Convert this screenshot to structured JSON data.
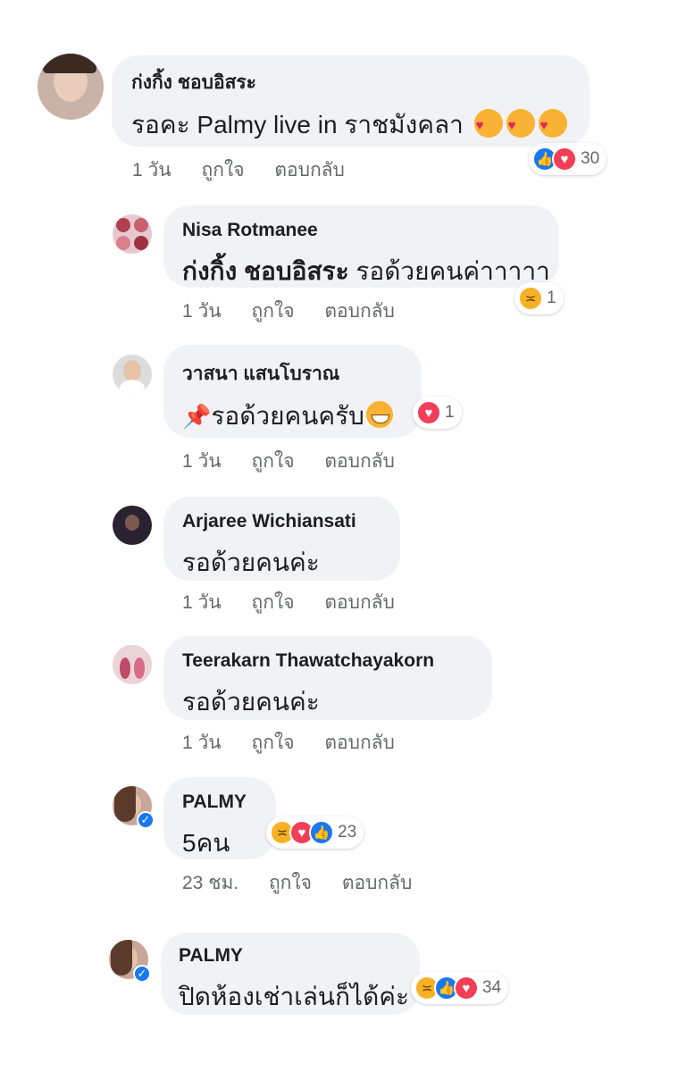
{
  "comments": [
    {
      "author": "ก่งกิ้ง ชอบอิสระ",
      "text": "รอคะ Palmy live in ราชมังคลา",
      "time": "1 วัน",
      "like": "ถูกใจ",
      "reply": "ตอบกลับ",
      "reaction_count": "30"
    },
    {
      "author": "Nisa Rotmanee",
      "mention": "ก่งกิ้ง ชอบอิสระ",
      "text": "รอด้วยคนค่าาาาา",
      "time": "1 วัน",
      "like": "ถูกใจ",
      "reply": "ตอบกลับ",
      "reaction_count": "1"
    },
    {
      "author": "วาสนา แสนโบราณ",
      "text": "รอด้วยคนครับ",
      "time": "1 วัน",
      "like": "ถูกใจ",
      "reply": "ตอบกลับ",
      "reaction_count": "1"
    },
    {
      "author": "Arjaree Wichiansati",
      "text": "รอด้วยคนค่ะ",
      "time": "1 วัน",
      "like": "ถูกใจ",
      "reply": "ตอบกลับ"
    },
    {
      "author": "Teerakarn Thawatchayakorn",
      "text": "รอด้วยคนค่ะ",
      "time": "1 วัน",
      "like": "ถูกใจ",
      "reply": "ตอบกลับ"
    },
    {
      "author": "PALMY",
      "text": "5คน",
      "time": "23 ชม.",
      "like": "ถูกใจ",
      "reply": "ตอบกลับ",
      "reaction_count": "23"
    },
    {
      "author": "PALMY",
      "text": "ปิดห้องเช่าเล่นก็ได้ค่ะ",
      "reaction_count": "34"
    }
  ],
  "icons": {
    "like": "like-reaction-icon",
    "love": "love-reaction-icon",
    "haha": "haha-reaction-icon",
    "kiss": "kissing-face-emoji",
    "pin": "pushpin-emoji",
    "grin": "grinning-face-emoji",
    "verified": "verified-badge-icon"
  },
  "colors": {
    "bubble": "#f0f2f5",
    "like": "#1877f2",
    "love": "#f33e58",
    "haha": "#f7b125",
    "meta": "#65676b"
  }
}
